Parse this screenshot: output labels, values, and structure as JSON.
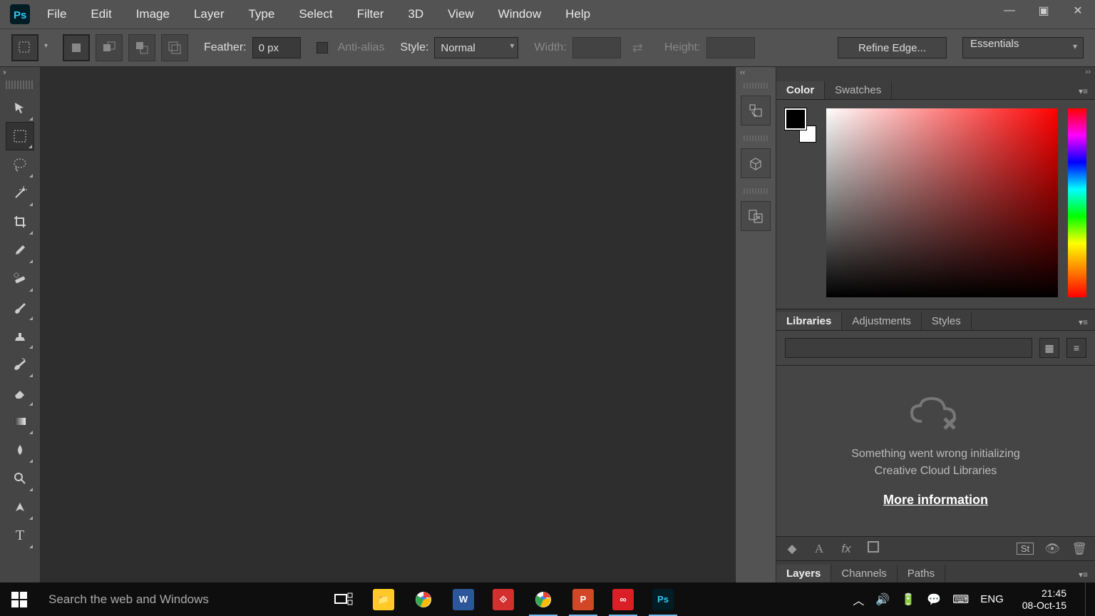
{
  "menu": [
    "File",
    "Edit",
    "Image",
    "Layer",
    "Type",
    "Select",
    "Filter",
    "3D",
    "View",
    "Window",
    "Help"
  ],
  "options": {
    "feather_label": "Feather:",
    "feather_value": "0 px",
    "antialias_label": "Anti-alias",
    "style_label": "Style:",
    "style_value": "Normal",
    "width_label": "Width:",
    "width_value": "",
    "height_label": "Height:",
    "height_value": "",
    "refine": "Refine Edge...",
    "workspace": "Essentials"
  },
  "panels": {
    "color_tabs": [
      "Color",
      "Swatches"
    ],
    "lib_tabs": [
      "Libraries",
      "Adjustments",
      "Styles"
    ],
    "lib_error_a": "Something went wrong initializing",
    "lib_error_b": "Creative Cloud Libraries",
    "more_info": "More information",
    "bottom_tabs": [
      "Layers",
      "Channels",
      "Paths"
    ]
  },
  "taskbar": {
    "search_placeholder": "Search the web and Windows",
    "lang": "ENG",
    "time": "21:45",
    "date": "08-Oct-15"
  }
}
